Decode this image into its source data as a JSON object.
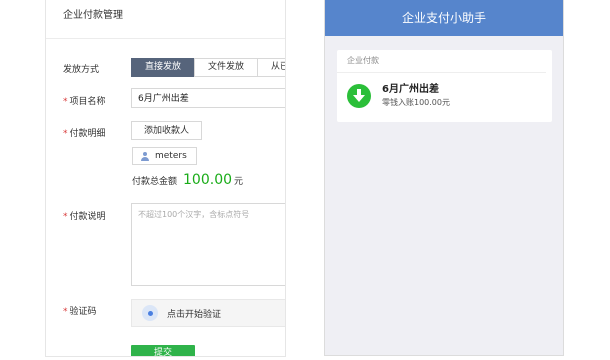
{
  "admin": {
    "title": "企业付款管理",
    "issue_method_label": "发放方式",
    "tabs": [
      {
        "label": "直接发放",
        "active": true
      },
      {
        "label": "文件发放",
        "active": false
      },
      {
        "label": "从已",
        "active": false
      }
    ],
    "required_mark": "*",
    "project_name_label": "项目名称",
    "project_name_value": "6月广州出差",
    "payment_detail_label": "付款明细",
    "add_payee_label": "添加收款人",
    "payee_name": "meters",
    "total_label": "付款总金额",
    "total_amount": "100.00",
    "total_unit": "元",
    "payment_note_label": "付款说明",
    "payment_note_placeholder": "不超过100个汉字，含标点符号",
    "captcha_label": "验证码",
    "verify_label": "点击开始验证",
    "submit_label": "提交"
  },
  "phone": {
    "header_title": "企业支付小助手",
    "card": {
      "category": "企业付款",
      "title": "6月广州出差",
      "subtitle": "零钱入账100.00元"
    }
  },
  "colors": {
    "tab_active": "#56647b",
    "amount_green": "#1aac19",
    "submit_green": "#2fb34a",
    "phone_header_blue": "#5685cc",
    "required_red": "#d83a3a"
  }
}
